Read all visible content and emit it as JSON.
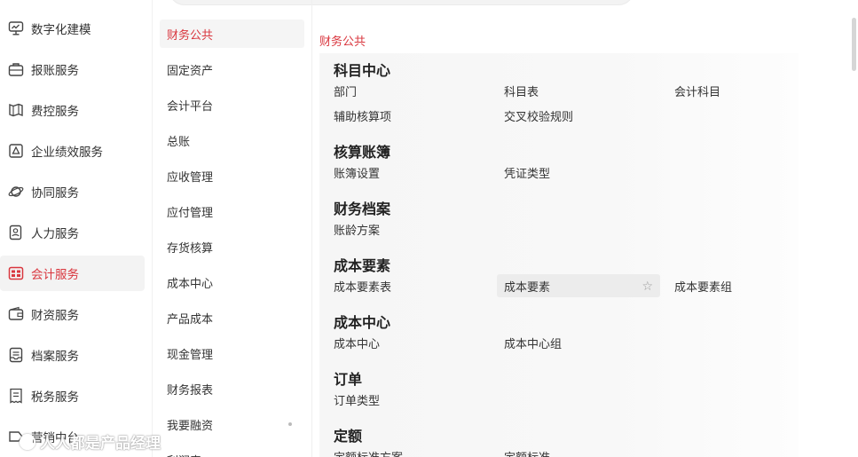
{
  "sidebar": {
    "items": [
      {
        "label": "数字化建模",
        "icon": "monitor-chart-icon"
      },
      {
        "label": "报账服务",
        "icon": "briefcase-icon"
      },
      {
        "label": "费控服务",
        "icon": "map-route-icon"
      },
      {
        "label": "企业绩效服务",
        "icon": "performance-icon"
      },
      {
        "label": "协同服务",
        "icon": "planet-icon"
      },
      {
        "label": "人力服务",
        "icon": "id-card-icon"
      },
      {
        "label": "会计服务",
        "icon": "accounting-icon",
        "active": true
      },
      {
        "label": "财资服务",
        "icon": "wallet-icon"
      },
      {
        "label": "档案服务",
        "icon": "archive-icon"
      },
      {
        "label": "税务服务",
        "icon": "receipt-icon"
      },
      {
        "label": "营销中台",
        "icon": "marketing-icon"
      }
    ]
  },
  "submenu": {
    "items": [
      "财务公共",
      "固定资产",
      "会计平台",
      "总账",
      "应收管理",
      "应付管理",
      "存货核算",
      "成本中心",
      "产品成本",
      "现金管理",
      "财务报表",
      "我要融资",
      "利润表"
    ],
    "active_index": 0
  },
  "content": {
    "breadcrumb": "财务公共",
    "groups": [
      {
        "title": "科目中心",
        "entries": [
          [
            "部门",
            "科目表",
            "会计科目"
          ],
          [
            "辅助核算项",
            "交叉校验规则"
          ]
        ]
      },
      {
        "title": "核算账簿",
        "entries": [
          [
            "账簿设置",
            "凭证类型"
          ]
        ]
      },
      {
        "title": "财务档案",
        "entries": [
          [
            "账龄方案"
          ]
        ]
      },
      {
        "title": "成本要素",
        "entries": [
          [
            "成本要素表",
            "成本要素",
            "成本要素组"
          ]
        ]
      },
      {
        "title": "成本中心",
        "entries": [
          [
            "成本中心",
            "成本中心组"
          ]
        ]
      },
      {
        "title": "订单",
        "entries": [
          [
            "订单类型"
          ]
        ]
      },
      {
        "title": "定额",
        "entries": [
          [
            "定额标准方案",
            "定额标准"
          ]
        ]
      }
    ],
    "hover_star": "☆"
  },
  "watermark": "人人都是产品经理",
  "colors": {
    "accent": "#d9363e",
    "active_bg": "#f3f3f3",
    "panel_bg": "#f6f6f6"
  }
}
